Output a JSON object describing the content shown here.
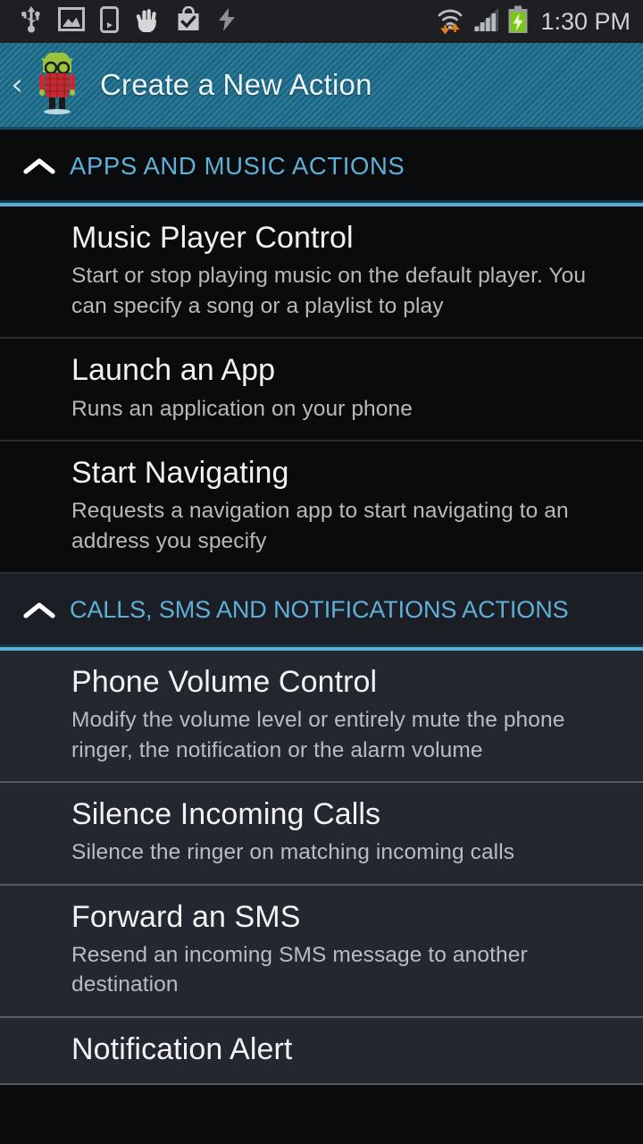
{
  "statusbar": {
    "time": "1:30 PM",
    "left_icons": [
      {
        "name": "usb-icon",
        "label": "USB connected"
      },
      {
        "name": "screenshot-image-icon",
        "label": "Screenshot captured"
      },
      {
        "name": "media-device-icon",
        "label": "Media device"
      },
      {
        "name": "hand-gesture-icon",
        "label": "Palm gesture"
      },
      {
        "name": "play-store-bag-icon",
        "label": "Play Store"
      },
      {
        "name": "lightning-bolt-icon",
        "label": "Power"
      }
    ],
    "right_icons": [
      {
        "name": "wifi-icon",
        "label": "Wi-Fi connected with data transfer"
      },
      {
        "name": "cell-signal-icon",
        "label": "Mobile signal"
      },
      {
        "name": "battery-charging-icon",
        "label": "Battery charging"
      }
    ]
  },
  "actionbar": {
    "back_label": "‹",
    "app_icon_name": "automateit-nerd-android-icon",
    "title": "Create a New Action"
  },
  "sections": [
    {
      "id": "apps-and-music",
      "title": "APPS AND MUSIC ACTIONS",
      "expanded": true,
      "collapse_icon": "chevron-up-icon",
      "theme": "dark",
      "items": [
        {
          "title": "Music Player Control",
          "desc": "Start or stop playing music on the default player. You can specify a song or a playlist to play"
        },
        {
          "title": "Launch an App",
          "desc": "Runs an application on your phone"
        },
        {
          "title": "Start Navigating",
          "desc": "Requests a navigation app to start navigating to an address you specify"
        }
      ]
    },
    {
      "id": "calls-sms-notifications",
      "title": "CALLS, SMS AND NOTIFICATIONS ACTIONS",
      "expanded": true,
      "collapse_icon": "chevron-up-icon",
      "theme": "blue",
      "items": [
        {
          "title": "Phone Volume Control",
          "desc": "Modify the volume level or entirely mute the phone ringer, the notification or the alarm volume"
        },
        {
          "title": "Silence Incoming Calls",
          "desc": "Silence the ringer on matching incoming calls"
        },
        {
          "title": "Forward an SMS",
          "desc": "Resend an incoming SMS message to another destination"
        },
        {
          "title": "Notification Alert",
          "desc": ""
        }
      ]
    }
  ],
  "colors": {
    "accent_blue": "#5cadd2",
    "section_title_blue": "#5fb0d8",
    "actionbar_teal": "#1d6e8e",
    "statusbar_bg": "#1d1f22",
    "list_dark_bg": "#0a0b0c",
    "list_blue_bg": "#222730",
    "battery_green": "#7bc618",
    "wifi_arrow_orange": "#e08020"
  }
}
